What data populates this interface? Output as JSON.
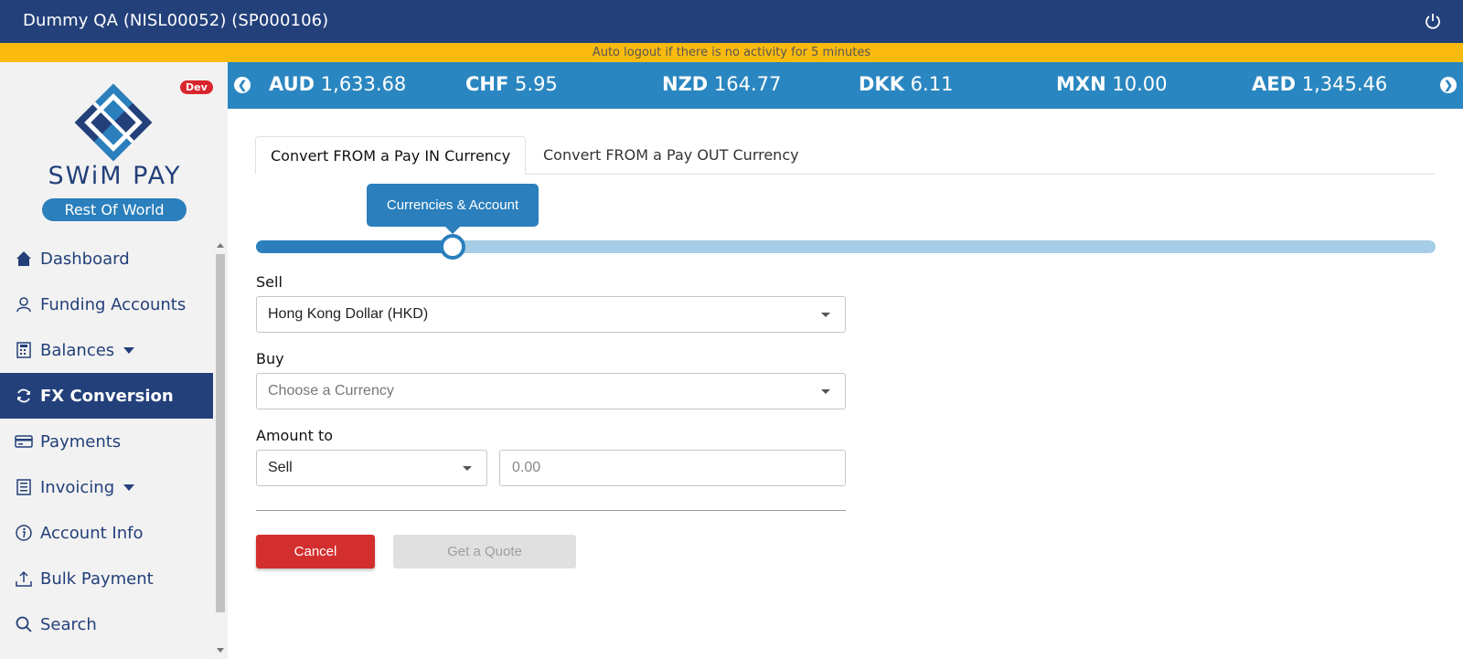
{
  "header": {
    "title": "Dummy QA (NISL00052) (SP000106)",
    "power_icon": "power-icon"
  },
  "notice": {
    "text": "Auto logout if there is no activity for 5 minutes"
  },
  "sidebar": {
    "dev_badge": "Dev",
    "brand": "SWiM PAY",
    "subbrand": "Rest Of World",
    "items": [
      {
        "label": "Dashboard",
        "icon": "home-icon"
      },
      {
        "label": "Funding Accounts",
        "icon": "user-icon"
      },
      {
        "label": "Balances",
        "icon": "calculator-icon"
      },
      {
        "label": "FX Conversion",
        "icon": "refresh-icon"
      },
      {
        "label": "Payments",
        "icon": "card-icon"
      },
      {
        "label": "Invoicing",
        "icon": "list-icon"
      },
      {
        "label": "Account Info",
        "icon": "info-icon"
      },
      {
        "label": "Bulk Payment",
        "icon": "upload-icon"
      },
      {
        "label": "Search",
        "icon": "search-icon"
      }
    ]
  },
  "ticker": {
    "rates": [
      {
        "code": "AUD",
        "value": "1,633.68"
      },
      {
        "code": "CHF",
        "value": "5.95"
      },
      {
        "code": "NZD",
        "value": "164.77"
      },
      {
        "code": "DKK",
        "value": "6.11"
      },
      {
        "code": "MXN",
        "value": "10.00"
      },
      {
        "code": "AED",
        "value": "1,345.46"
      }
    ]
  },
  "tabs": [
    {
      "label": "Convert FROM a Pay IN Currency"
    },
    {
      "label": "Convert FROM a Pay OUT Currency"
    }
  ],
  "stepper": {
    "label": "Currencies & Account",
    "progress": 0.17
  },
  "form": {
    "sell_label": "Sell",
    "sell_value": "Hong Kong Dollar (HKD)",
    "buy_label": "Buy",
    "buy_placeholder": "Choose a Currency",
    "amount_label": "Amount to",
    "amount_type": "Sell",
    "amount_value": "0.00"
  },
  "buttons": {
    "cancel": "Cancel",
    "quote": "Get a Quote"
  }
}
